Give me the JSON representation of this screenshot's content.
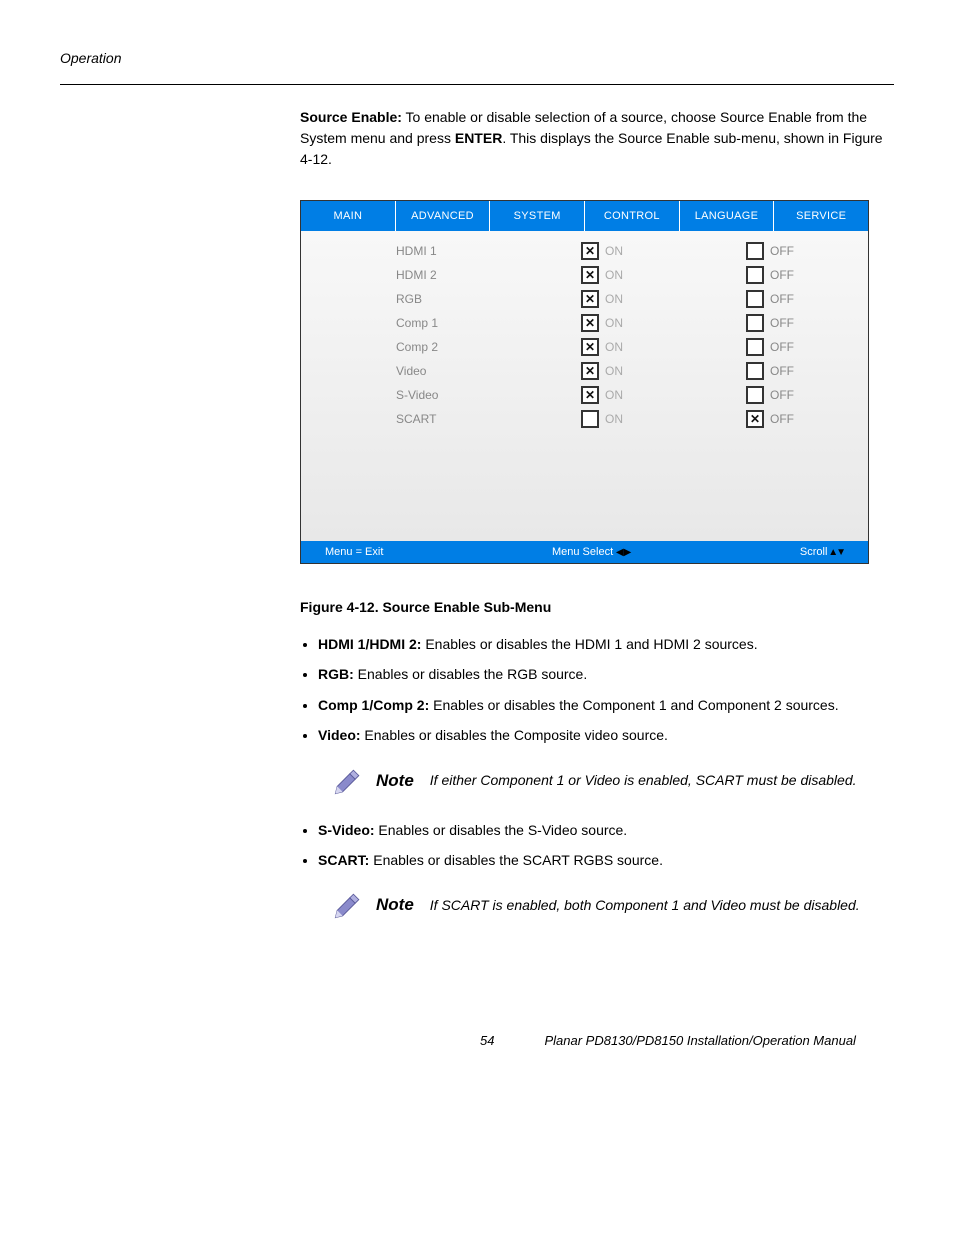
{
  "header": {
    "section": "Operation"
  },
  "intro": {
    "bold1": "Source Enable:",
    "text1": " To enable or disable selection of a source, choose Source Enable from the System menu and press ",
    "bold2": "ENTER",
    "text2": ". This displays the Source Enable sub-menu, shown in Figure 4-12."
  },
  "osd": {
    "tabs": [
      "MAIN",
      "ADVANCED",
      "SYSTEM",
      "CONTROL",
      "LANGUAGE",
      "SERVICE"
    ],
    "rows": [
      {
        "label": "HDMI 1",
        "on": true,
        "off": false,
        "on_label": "ON",
        "off_label": "OFF"
      },
      {
        "label": "HDMI 2",
        "on": true,
        "off": false,
        "on_label": "ON",
        "off_label": "OFF"
      },
      {
        "label": "RGB",
        "on": true,
        "off": false,
        "on_label": "ON",
        "off_label": "OFF"
      },
      {
        "label": "Comp 1",
        "on": true,
        "off": false,
        "on_label": "ON",
        "off_label": "OFF"
      },
      {
        "label": "Comp 2",
        "on": true,
        "off": false,
        "on_label": "ON",
        "off_label": "OFF"
      },
      {
        "label": "Video",
        "on": true,
        "off": false,
        "on_label": "ON",
        "off_label": "OFF"
      },
      {
        "label": "S-Video",
        "on": true,
        "off": false,
        "on_label": "ON",
        "off_label": "OFF"
      },
      {
        "label": "SCART",
        "on": false,
        "off": true,
        "on_label": "ON",
        "off_label": "OFF"
      }
    ],
    "footer": {
      "left": "Menu = Exit",
      "mid": "Menu Select",
      "right": "Scroll"
    }
  },
  "figure_caption": "Figure 4-12. Source Enable Sub-Menu",
  "bullets1": [
    {
      "bold": "HDMI 1/HDMI 2:",
      "text": " Enables or disables the HDMI 1 and HDMI 2 sources."
    },
    {
      "bold": "RGB:",
      "text": " Enables or disables the RGB source."
    },
    {
      "bold": "Comp 1/Comp 2:",
      "text": " Enables or disables the Component 1 and Component 2 sources."
    },
    {
      "bold": "Video:",
      "text": " Enables or disables the Composite video source."
    }
  ],
  "note1": {
    "label": "Note",
    "text": "If either Component 1 or Video is enabled, SCART must be disabled."
  },
  "bullets2": [
    {
      "bold": "S-Video:",
      "text": " Enables or disables the S-Video source."
    },
    {
      "bold": "SCART:",
      "text": " Enables or disables the SCART RGBS source."
    }
  ],
  "note2": {
    "label": "Note",
    "text": "If SCART is enabled, both Component 1 and Video must be disabled."
  },
  "footer": {
    "page": "54",
    "text": "Planar PD8130/PD8150 Installation/Operation Manual"
  }
}
